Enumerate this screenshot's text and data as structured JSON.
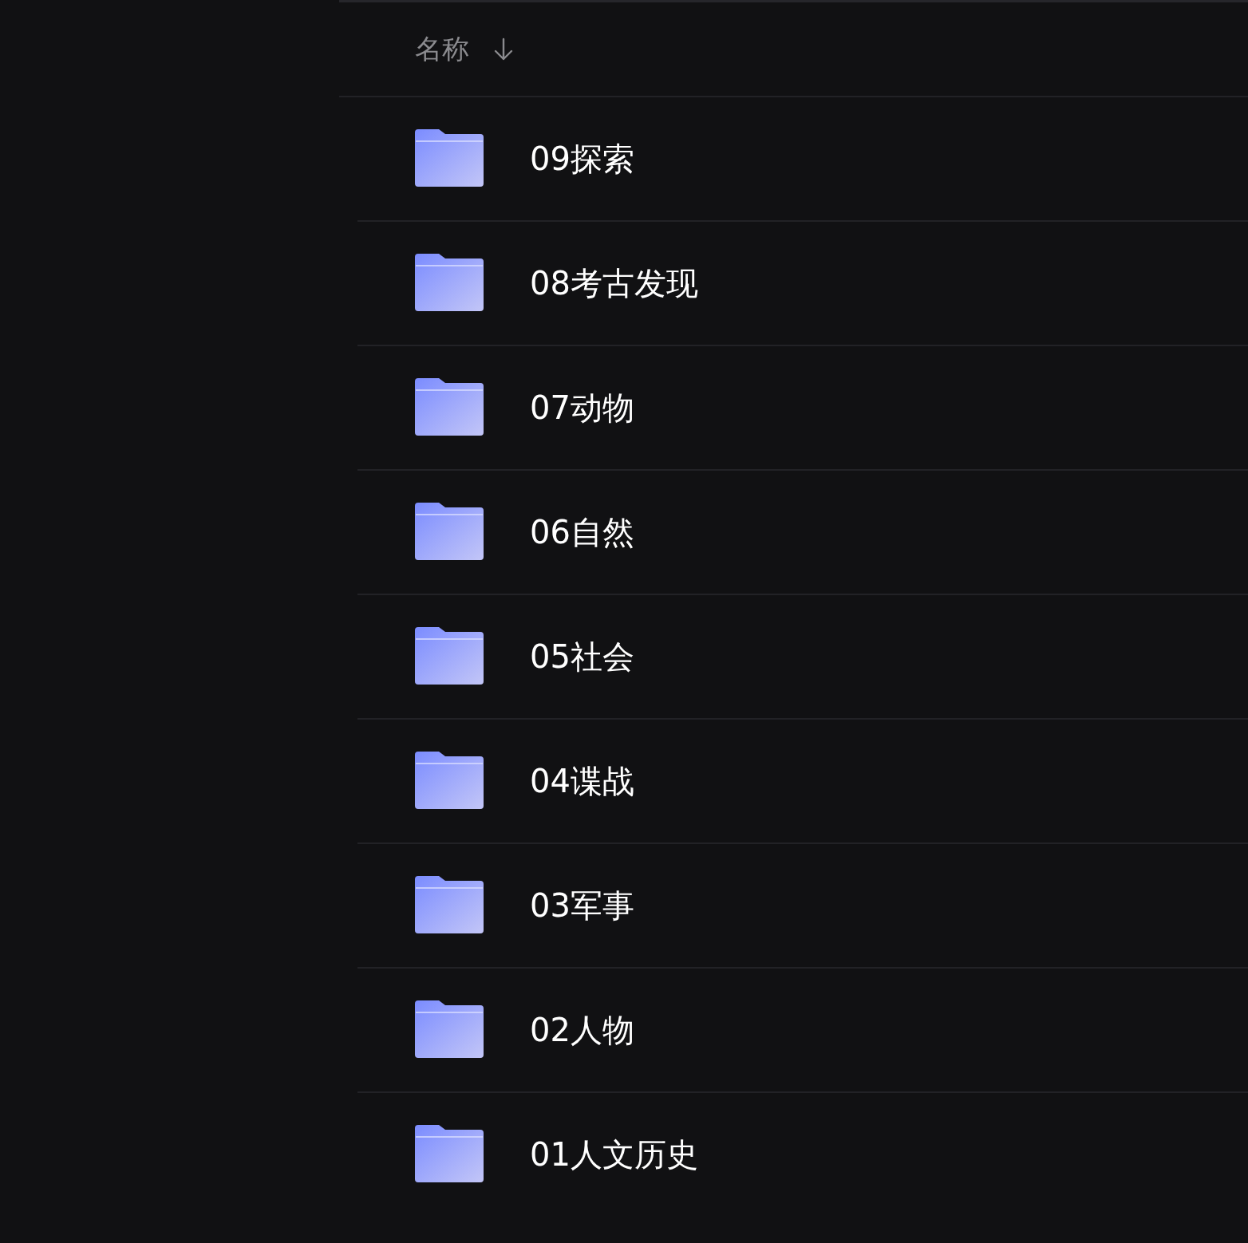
{
  "header": {
    "label": "名称"
  },
  "items": [
    {
      "kind": "folder",
      "name": "09探索"
    },
    {
      "kind": "folder",
      "name": "08考古发现"
    },
    {
      "kind": "folder",
      "name": "07动物"
    },
    {
      "kind": "folder",
      "name": "06自然"
    },
    {
      "kind": "folder",
      "name": "05社会"
    },
    {
      "kind": "folder",
      "name": "04谍战"
    },
    {
      "kind": "folder",
      "name": "03军事"
    },
    {
      "kind": "folder",
      "name": "02人物"
    },
    {
      "kind": "folder",
      "name": "01人文历史"
    }
  ]
}
